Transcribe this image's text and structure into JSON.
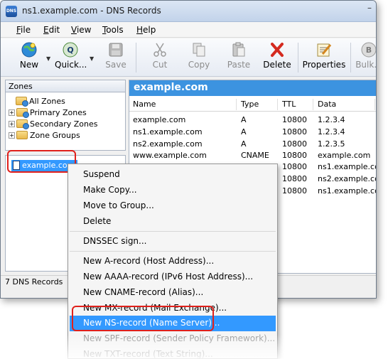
{
  "window": {
    "title": "ns1.example.com - DNS Records",
    "app_icon_text": "DNS",
    "minimize_glyph": "–"
  },
  "menubar": {
    "items": [
      {
        "key": "F",
        "rest": "ile"
      },
      {
        "key": "E",
        "rest": "dit"
      },
      {
        "key": "V",
        "rest": "iew"
      },
      {
        "key": "T",
        "rest": "ools"
      },
      {
        "key": "H",
        "rest": "elp"
      }
    ]
  },
  "toolbar": {
    "buttons": [
      {
        "label": "New",
        "icon": "globe-new-icon",
        "enabled": true
      },
      {
        "label": "Quick...",
        "icon": "quick-query-icon",
        "enabled": true
      },
      {
        "label": "Save",
        "icon": "floppy-disk-icon",
        "enabled": false
      },
      {
        "label": "Cut",
        "icon": "scissors-icon",
        "enabled": false
      },
      {
        "label": "Copy",
        "icon": "copy-icon",
        "enabled": false
      },
      {
        "label": "Paste",
        "icon": "paste-icon",
        "enabled": false
      },
      {
        "label": "Delete",
        "icon": "red-x-icon",
        "enabled": true
      },
      {
        "label": "Properties",
        "icon": "properties-icon",
        "enabled": true
      },
      {
        "label": "Bulk...",
        "icon": "bulk-icon",
        "enabled": false
      }
    ],
    "dropdown_glyph": "▼"
  },
  "left_pane": {
    "header": "Zones",
    "tree": [
      {
        "label": "All Zones",
        "expander": ""
      },
      {
        "label": "Primary Zones",
        "expander": "+"
      },
      {
        "label": "Secondary Zones",
        "expander": "+"
      },
      {
        "label": "Zone Groups",
        "expander": "+"
      }
    ],
    "selected_zone": "example.com"
  },
  "right_pane": {
    "zone_title": "example.com",
    "columns": [
      "Name",
      "Type",
      "TTL",
      "Data"
    ],
    "rows": [
      {
        "name": "example.com",
        "type": "A",
        "ttl": "10800",
        "data": "1.2.3.4"
      },
      {
        "name": "ns1.example.com",
        "type": "A",
        "ttl": "10800",
        "data": "1.2.3.4"
      },
      {
        "name": "ns2.example.com",
        "type": "A",
        "ttl": "10800",
        "data": "1.2.3.5"
      },
      {
        "name": "www.example.com",
        "type": "CNAME",
        "ttl": "10800",
        "data": "example.com"
      },
      {
        "name": "",
        "type": "",
        "ttl": "10800",
        "data": "ns1.example.com"
      },
      {
        "name": "",
        "type": "",
        "ttl": "10800",
        "data": "ns2.example.com"
      },
      {
        "name": "",
        "type": "",
        "ttl": "10800",
        "data": "ns1.example.com"
      }
    ]
  },
  "status_bar": {
    "text": "7 DNS Records"
  },
  "context_menu": {
    "items": [
      {
        "label": "Suspend"
      },
      {
        "label": "Make Copy..."
      },
      {
        "label": "Move to Group..."
      },
      {
        "label": "Delete"
      },
      {
        "label": "DNSSEC sign..."
      },
      {
        "label": "New A-record (Host Address)..."
      },
      {
        "label": "New AAAA-record (IPv6 Host Address)..."
      },
      {
        "label": "New CNAME-record (Alias)..."
      },
      {
        "label": "New MX-record (Mail Exchange)..."
      },
      {
        "label": "New NS-record (Name Server)..."
      },
      {
        "label": "New SPF-record (Sender Policy Framework)..."
      },
      {
        "label": "New TXT-record (Text String)..."
      }
    ]
  },
  "colors": {
    "selection": "#3399ff",
    "zone_title_bg": "#3c93e0",
    "callout": "#e0201b"
  }
}
